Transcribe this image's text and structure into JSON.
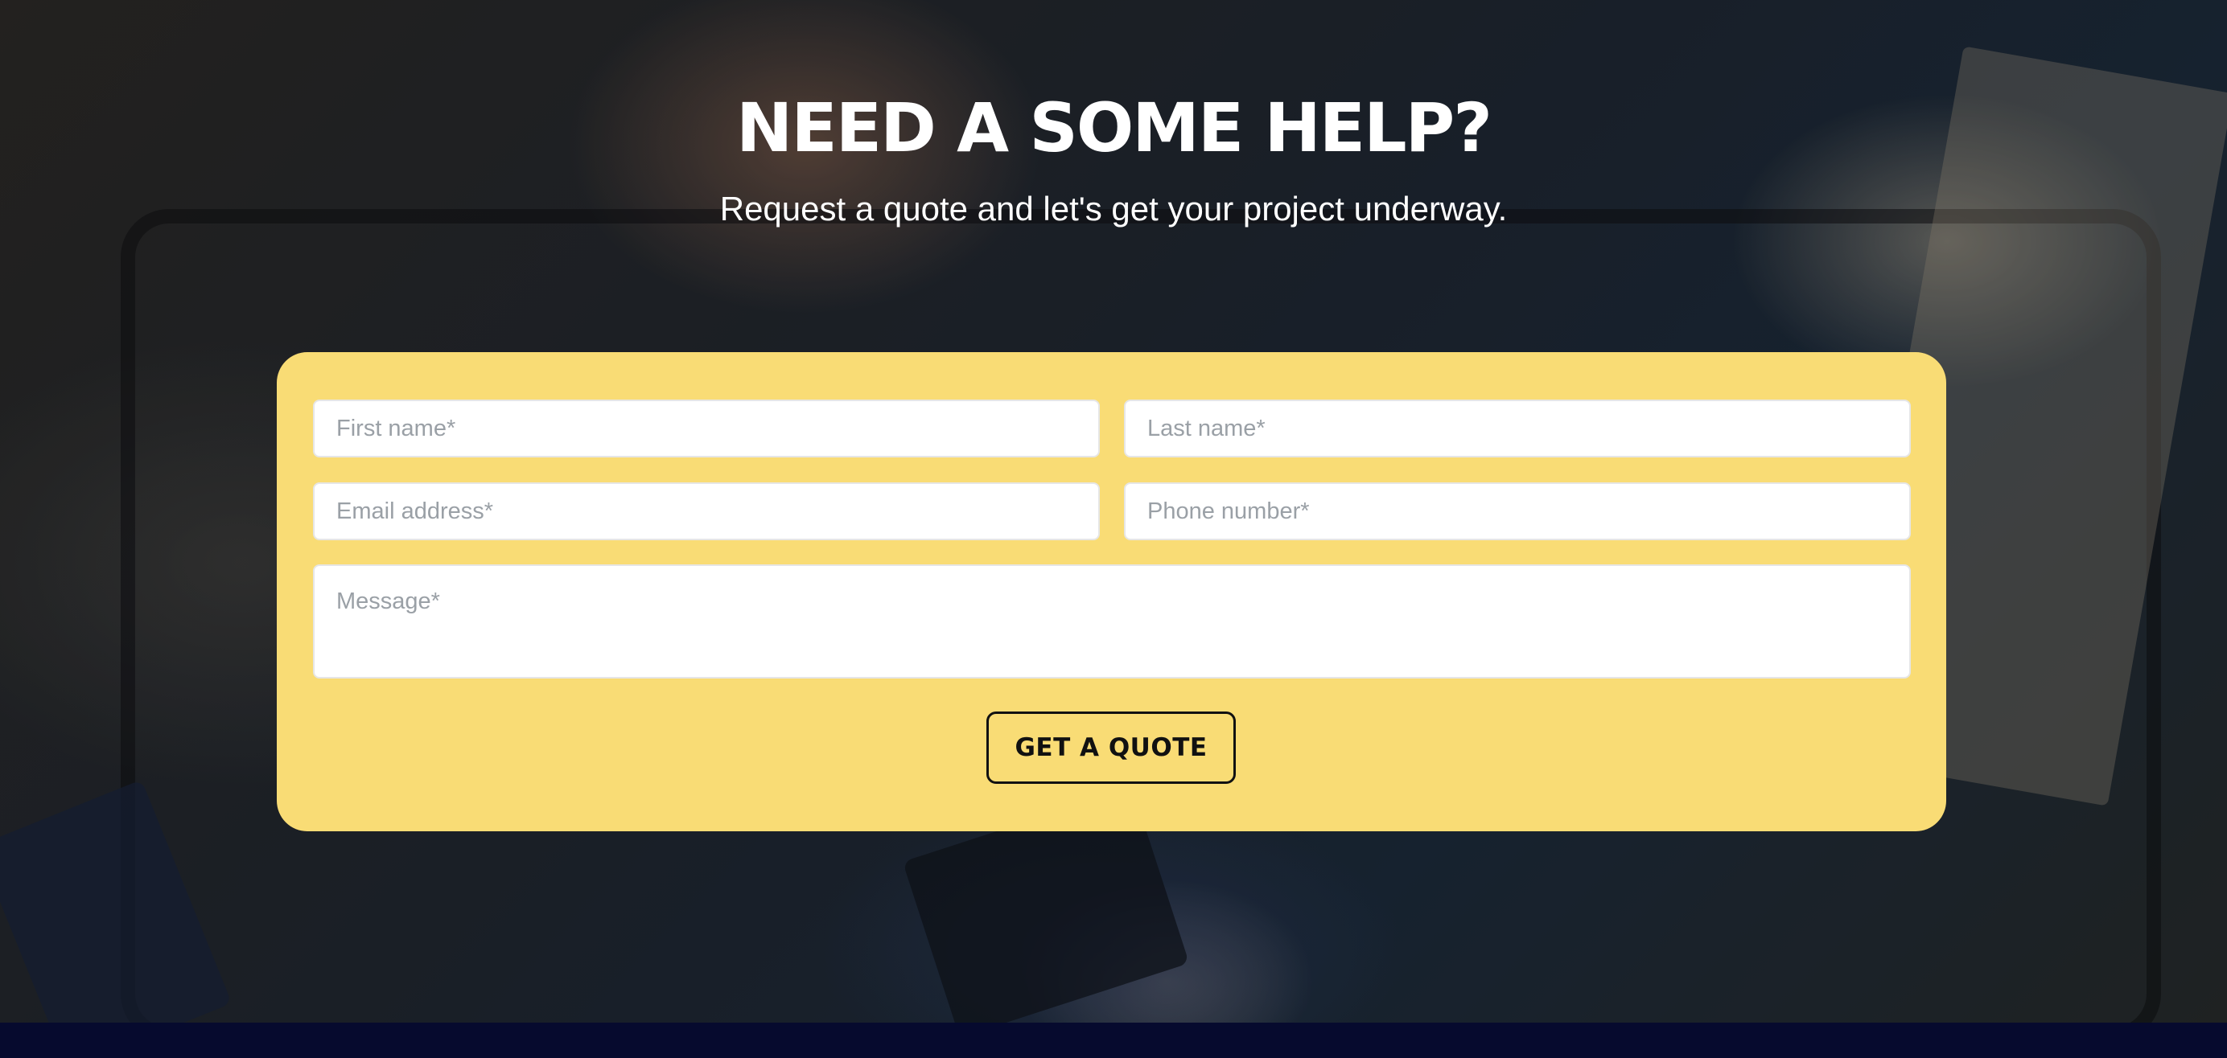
{
  "hero": {
    "title": "NEED A SOME HELP?",
    "subtitle": "Request a quote and let's get your project underway."
  },
  "form": {
    "first_name_placeholder": "First name*",
    "last_name_placeholder": "Last name*",
    "email_placeholder": "Email address*",
    "phone_placeholder": "Phone number*",
    "message_placeholder": "Message*",
    "submit_label": "GET A QUOTE"
  },
  "colors": {
    "card_background": "#f9dc75",
    "footer_bar": "#060a2e",
    "heading_text": "#ffffff"
  }
}
